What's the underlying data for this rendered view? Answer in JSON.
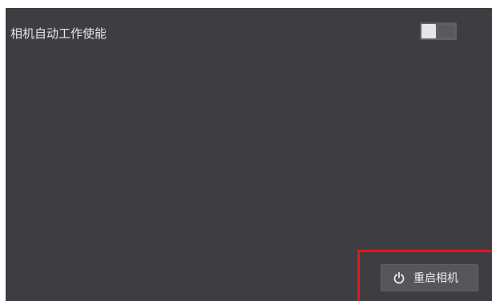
{
  "settings": {
    "auto_work_label": "相机自动工作使能",
    "auto_work_enabled": false
  },
  "actions": {
    "restart_label": "重启相机",
    "restart_icon": "power-restart-icon"
  },
  "colors": {
    "panel_bg": "#3e3e42",
    "highlight": "#e8141d",
    "button_bg": "#56565a"
  }
}
